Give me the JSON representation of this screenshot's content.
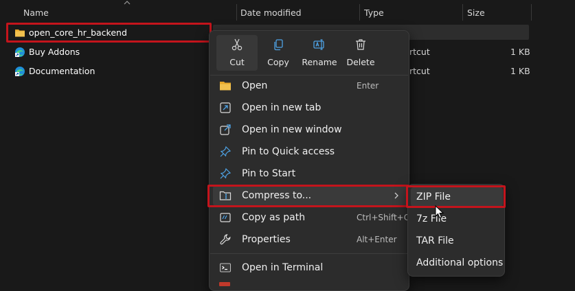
{
  "columns": {
    "name": "Name",
    "date_modified": "Date modified",
    "type": "Type",
    "size": "Size"
  },
  "files": [
    {
      "name": "open_core_hr_backend",
      "icon": "folder-icon",
      "date": "",
      "type": "",
      "size": ""
    },
    {
      "name": "Buy Addons",
      "icon": "edge-shortcut-icon",
      "date": "",
      "type": "rtcut",
      "size": "1 KB"
    },
    {
      "name": "Documentation",
      "icon": "edge-shortcut-icon",
      "date": "",
      "type": "rtcut",
      "size": "1 KB"
    }
  ],
  "context_menu": {
    "quick_actions": [
      {
        "label": "Cut",
        "icon": "scissors-icon"
      },
      {
        "label": "Copy",
        "icon": "copy-icon"
      },
      {
        "label": "Rename",
        "icon": "rename-icon"
      },
      {
        "label": "Delete",
        "icon": "trash-icon"
      }
    ],
    "items": [
      {
        "label": "Open",
        "shortcut": "Enter",
        "icon": "folder-open-icon"
      },
      {
        "label": "Open in new tab",
        "shortcut": "",
        "icon": "new-tab-icon"
      },
      {
        "label": "Open in new window",
        "shortcut": "",
        "icon": "new-window-icon"
      },
      {
        "label": "Pin to Quick access",
        "shortcut": "",
        "icon": "pin-icon"
      },
      {
        "label": "Pin to Start",
        "shortcut": "",
        "icon": "pin-icon"
      },
      {
        "label": "Compress to...",
        "shortcut": "",
        "icon": "zip-folder-icon"
      },
      {
        "label": "Copy as path",
        "shortcut": "Ctrl+Shift+C",
        "icon": "copy-path-icon"
      },
      {
        "label": "Properties",
        "shortcut": "Alt+Enter",
        "icon": "wrench-icon"
      },
      {
        "label": "Open in Terminal",
        "shortcut": "",
        "icon": "terminal-icon"
      }
    ]
  },
  "compress_submenu": {
    "items": [
      {
        "label": "ZIP File"
      },
      {
        "label": "7z File"
      },
      {
        "label": "TAR File"
      },
      {
        "label": "Additional options"
      }
    ]
  },
  "colors": {
    "background": "#191919",
    "menu": "#2c2c2c",
    "highlight": "#c4141c",
    "folder": "#f2c14e",
    "accent": "#4ea3e6"
  }
}
